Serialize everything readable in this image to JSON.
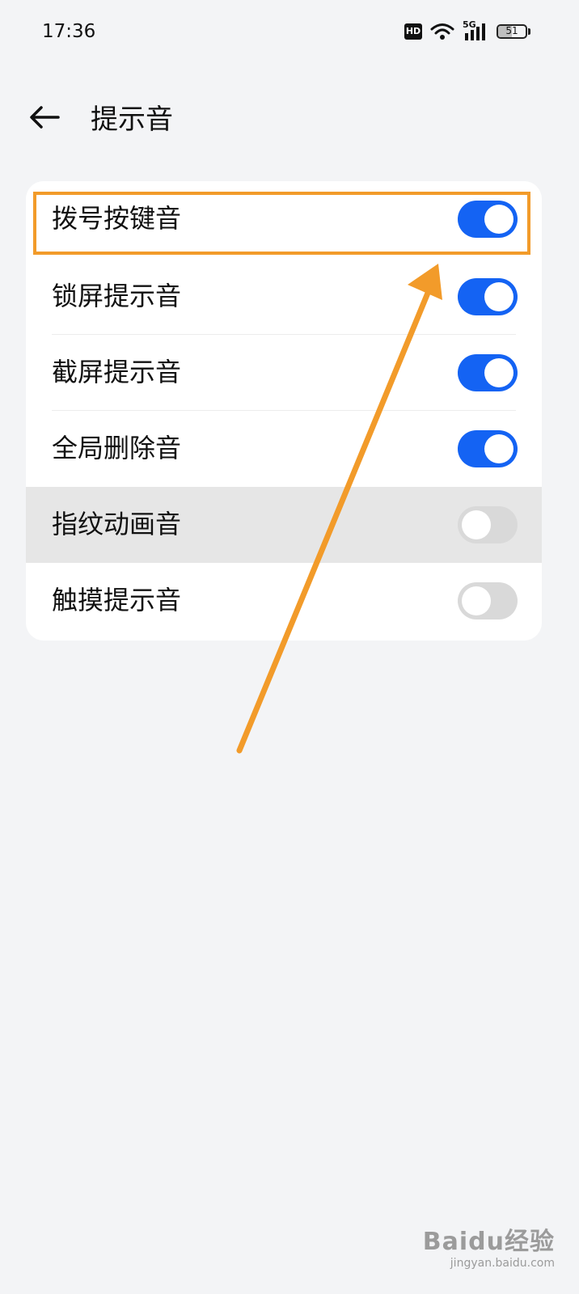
{
  "status_bar": {
    "time": "17:36",
    "hd_label": "HD",
    "network_label": "5G",
    "battery_level": "51"
  },
  "header": {
    "back_icon": "arrow-left-icon",
    "title": "提示音"
  },
  "settings": {
    "items": [
      {
        "label": "拨号按键音",
        "enabled": true
      },
      {
        "label": "锁屏提示音",
        "enabled": true
      },
      {
        "label": "截屏提示音",
        "enabled": true
      },
      {
        "label": "全局删除音",
        "enabled": true
      },
      {
        "label": "指纹动画音",
        "enabled": false
      },
      {
        "label": "触摸提示音",
        "enabled": false
      }
    ]
  },
  "watermark": {
    "main": "Baidu经验",
    "sub": "jingyan.baidu.com"
  },
  "colors": {
    "accent": "#1463f3",
    "annotation": "#f29b2a",
    "background": "#f3f4f6"
  }
}
